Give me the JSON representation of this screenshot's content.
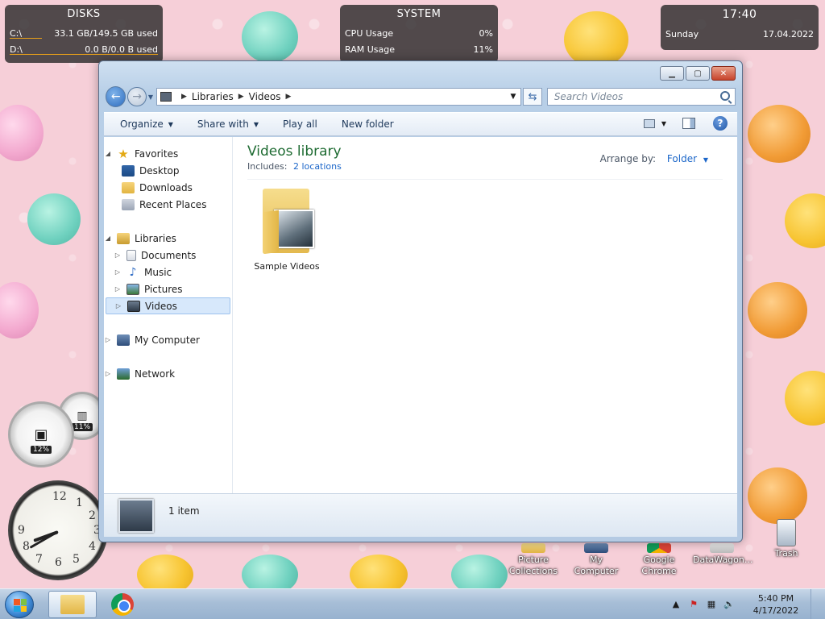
{
  "gadgets": {
    "disks": {
      "title": "DISKS",
      "rows": [
        {
          "drive": "C:\\",
          "usage": "33.1 GB/149.5 GB used"
        },
        {
          "drive": "D:\\",
          "usage": "0.0 B/0.0 B used"
        }
      ]
    },
    "system": {
      "title": "SYSTEM",
      "rows": [
        {
          "label": "CPU Usage",
          "value": "0%"
        },
        {
          "label": "RAM Usage",
          "value": "11%"
        }
      ]
    },
    "clock": {
      "time": "17:40",
      "day": "Sunday",
      "date": "17.04.2022"
    }
  },
  "window": {
    "address": {
      "segments": [
        "Libraries",
        "Videos"
      ]
    },
    "search": {
      "placeholder": "Search Videos"
    },
    "commands": {
      "organize": "Organize",
      "share_with": "Share with",
      "play_all": "Play all",
      "new_folder": "New folder"
    },
    "nav_pane": {
      "favorites": "Favorites",
      "desktop": "Desktop",
      "downloads": "Downloads",
      "recent_places": "Recent Places",
      "libraries": "Libraries",
      "documents": "Documents",
      "music": "Music",
      "pictures": "Pictures",
      "videos": "Videos",
      "my_computer": "My Computer",
      "network": "Network"
    },
    "content": {
      "title": "Videos library",
      "includes_label": "Includes:",
      "includes_link": "2 locations",
      "arrange_label": "Arrange by:",
      "arrange_value": "Folder",
      "items": [
        {
          "name": "Sample Videos"
        }
      ]
    },
    "status": {
      "count": "1 item"
    }
  },
  "desktop_gauges": {
    "cpu_label": "12%",
    "ram_label": "11%"
  },
  "desktop_icons": [
    {
      "label": "Picture Collections"
    },
    {
      "label": "My Computer"
    },
    {
      "label": "Google Chrome"
    },
    {
      "label": "DataWagon..."
    },
    {
      "label": "Trash"
    }
  ],
  "taskbar": {
    "time": "5:40 PM",
    "date": "4/17/2022"
  },
  "colors": {
    "accent_link": "#1b66c9",
    "library_title": "#1e6b32",
    "desktop_bg": "#f6cfd8",
    "close_button": "#c7432b"
  }
}
